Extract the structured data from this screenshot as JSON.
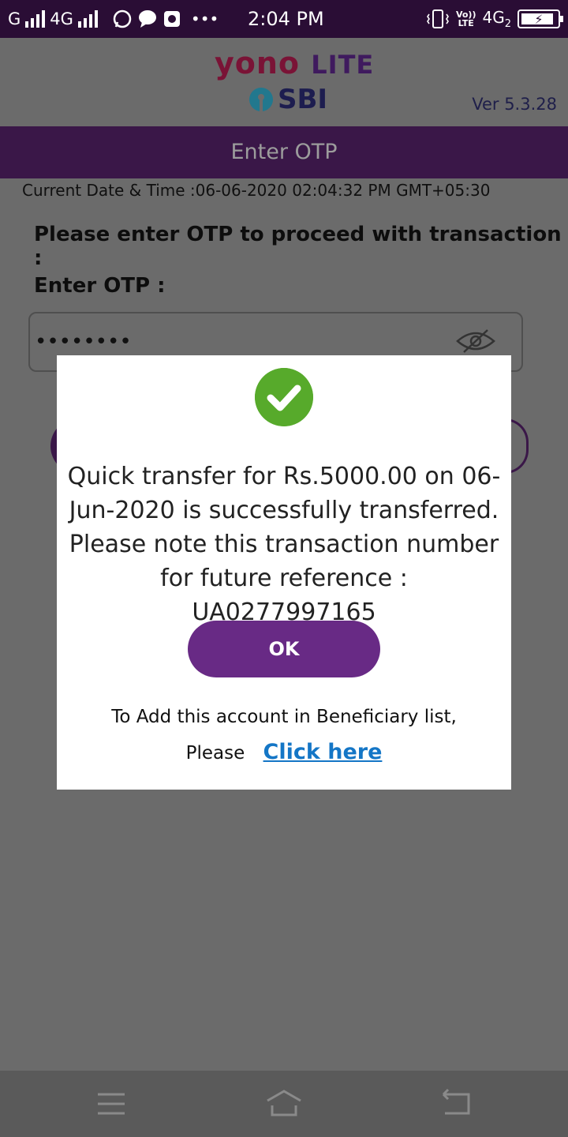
{
  "status_bar": {
    "carrier1": "G",
    "carrier2": "4G",
    "time": "2:04 PM",
    "volte_top": "Vo))",
    "volte_bottom": "LTE",
    "network": "4G",
    "network_sub": "2"
  },
  "header": {
    "logo_yono": "yono",
    "logo_lite": "LITE",
    "logo_sbi": "SBI",
    "version": "Ver 5.3.28",
    "title": "Enter OTP"
  },
  "form": {
    "datetime": "Current Date & Time :06-06-2020 02:04:32 PM GMT+05:30",
    "prompt": "Please enter OTP to proceed with transaction :",
    "otp_label": "Enter OTP :",
    "otp_value": "••••••••"
  },
  "dialog": {
    "message": "Quick transfer for Rs.5000.00 on 06-Jun-2020 is successfully transferred. Please note this transaction number for future reference : UA0277997165",
    "ok_label": "OK",
    "beneficiary_line1": "To Add this account in Beneficiary list,",
    "beneficiary_please": "Please",
    "beneficiary_link": "Click here"
  },
  "colors": {
    "primary_purple": "#682a85",
    "success_green": "#57aa2b",
    "link_blue": "#1476c6"
  },
  "icons": [
    "menu-icon",
    "home-icon",
    "back-icon",
    "eye-slash-icon",
    "check-icon"
  ]
}
